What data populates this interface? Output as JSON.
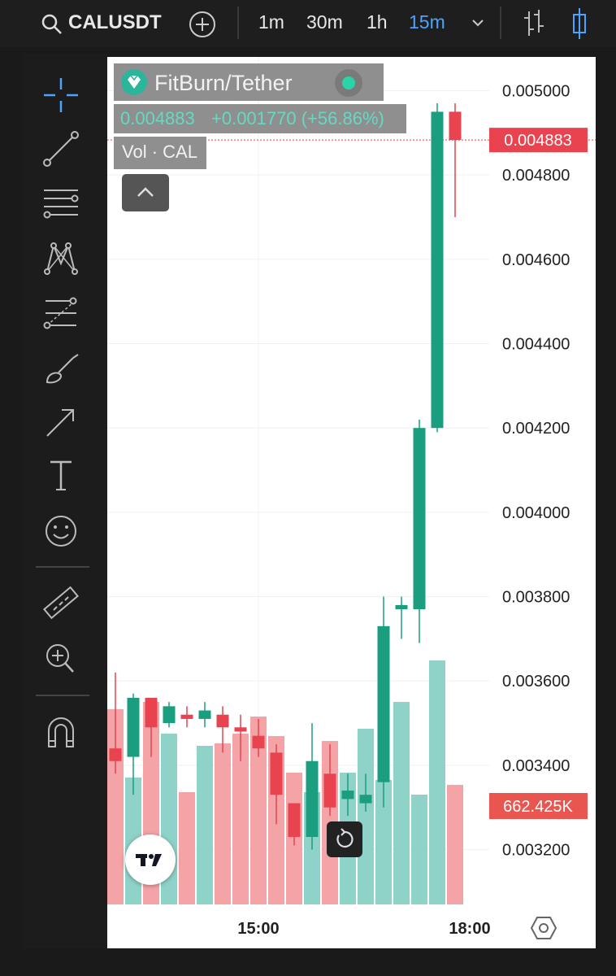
{
  "header": {
    "symbol": "CALUSDT",
    "timeframes": [
      {
        "label": "1m",
        "active": false
      },
      {
        "label": "30m",
        "active": false
      },
      {
        "label": "1h",
        "active": false
      },
      {
        "label": "15m",
        "active": true
      }
    ]
  },
  "legend": {
    "title": "FitBurn/Tether",
    "price": "0.004883",
    "change": "+0.001770 (+56.86%)",
    "volume_label": "Vol · CAL"
  },
  "colors": {
    "up": "#1a9e7f",
    "down": "#e8434f",
    "vol_up": "#8fd3c8",
    "vol_down": "#f4a4a6",
    "accent": "#4da3ff"
  },
  "chart_data": {
    "type": "candlestick",
    "ylim": [
      0.00307,
      0.00508
    ],
    "y_ticks": [
      "0.005000",
      "0.004800",
      "0.004600",
      "0.004400",
      "0.004200",
      "0.004000",
      "0.003800",
      "0.003600",
      "0.003400",
      "0.003200"
    ],
    "x_ticks": [
      "15:00",
      "18:00"
    ],
    "last_price_label": "0.004883",
    "last_price": 0.004883,
    "volume_label": "662.425K",
    "candles": [
      {
        "o": 0.00344,
        "h": 0.00362,
        "l": 0.00338,
        "c": 0.00341
      },
      {
        "o": 0.00342,
        "h": 0.00357,
        "l": 0.00333,
        "c": 0.00356
      },
      {
        "o": 0.00356,
        "h": 0.00356,
        "l": 0.00342,
        "c": 0.00349
      },
      {
        "o": 0.0035,
        "h": 0.00355,
        "l": 0.00349,
        "c": 0.00354
      },
      {
        "o": 0.00352,
        "h": 0.00354,
        "l": 0.00349,
        "c": 0.00351
      },
      {
        "o": 0.00351,
        "h": 0.00355,
        "l": 0.00349,
        "c": 0.00353
      },
      {
        "o": 0.00352,
        "h": 0.00354,
        "l": 0.00343,
        "c": 0.00349
      },
      {
        "o": 0.00349,
        "h": 0.00352,
        "l": 0.00341,
        "c": 0.00348
      },
      {
        "o": 0.00347,
        "h": 0.00351,
        "l": 0.00342,
        "c": 0.00344
      },
      {
        "o": 0.00343,
        "h": 0.00345,
        "l": 0.00326,
        "c": 0.00333
      },
      {
        "o": 0.00331,
        "h": 0.00331,
        "l": 0.00321,
        "c": 0.00323
      },
      {
        "o": 0.00323,
        "h": 0.0035,
        "l": 0.0032,
        "c": 0.00341
      },
      {
        "o": 0.00338,
        "h": 0.00345,
        "l": 0.00328,
        "c": 0.0033
      },
      {
        "o": 0.00332,
        "h": 0.00338,
        "l": 0.00328,
        "c": 0.00334
      },
      {
        "o": 0.00331,
        "h": 0.00338,
        "l": 0.00329,
        "c": 0.00333
      },
      {
        "o": 0.00336,
        "h": 0.0038,
        "l": 0.0033,
        "c": 0.00373
      },
      {
        "o": 0.00377,
        "h": 0.0038,
        "l": 0.0037,
        "c": 0.00378
      },
      {
        "o": 0.00377,
        "h": 0.00422,
        "l": 0.00369,
        "c": 0.0042
      },
      {
        "o": 0.0042,
        "h": 0.00497,
        "l": 0.00419,
        "c": 0.00495
      },
      {
        "o": 0.00495,
        "h": 0.00497,
        "l": 0.0047,
        "c": 0.004883
      }
    ],
    "volume": [
      0.8,
      0.52,
      0.83,
      0.7,
      0.46,
      0.65,
      0.66,
      0.7,
      0.77,
      0.69,
      0.54,
      0.46,
      0.67,
      0.54,
      0.72,
      0.51,
      0.83,
      0.45,
      1.0,
      0.49
    ],
    "volume_unit": "relative to largest visible bar"
  }
}
